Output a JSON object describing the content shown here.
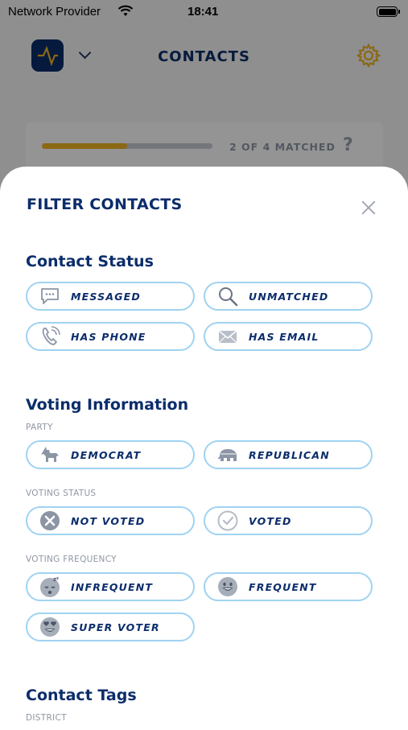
{
  "status_bar": {
    "carrier": "Network Provider",
    "time": "18:41"
  },
  "header": {
    "title": "CONTACTS"
  },
  "progress": {
    "label": "2 OF 4 MATCHED",
    "matched": 2,
    "total": 4,
    "help": "?"
  },
  "sheet": {
    "title": "FILTER CONTACTS",
    "contact_status": {
      "title": "Contact Status",
      "chips": [
        {
          "label": "MESSAGED",
          "icon": "speech-bubble-icon"
        },
        {
          "label": "UNMATCHED",
          "icon": "magnifier-icon"
        },
        {
          "label": "HAS PHONE",
          "icon": "phone-icon"
        },
        {
          "label": "HAS EMAIL",
          "icon": "envelope-icon"
        }
      ]
    },
    "voting_information": {
      "title": "Voting Information",
      "party_label": "PARTY",
      "party_chips": [
        {
          "label": "DEMOCRAT",
          "icon": "donkey-icon"
        },
        {
          "label": "REPUBLICAN",
          "icon": "elephant-icon"
        }
      ],
      "status_label": "VOTING STATUS",
      "status_chips": [
        {
          "label": "NOT VOTED",
          "icon": "x-circle-icon"
        },
        {
          "label": "VOTED",
          "icon": "check-circle-icon"
        }
      ],
      "frequency_label": "VOTING FREQUENCY",
      "frequency_chips": [
        {
          "label": "INFREQUENT",
          "icon": "sleepy-face-icon"
        },
        {
          "label": "FREQUENT",
          "icon": "smile-face-icon"
        },
        {
          "label": "SUPER VOTER",
          "icon": "heart-eyes-face-icon"
        }
      ]
    },
    "contact_tags": {
      "title": "Contact Tags",
      "district_label": "DISTRICT"
    }
  },
  "colors": {
    "brand_navy": "#0c2d6b",
    "accent_yellow": "#f0b323",
    "chip_border": "#9fd3f2",
    "muted_text": "#8f97a3"
  }
}
